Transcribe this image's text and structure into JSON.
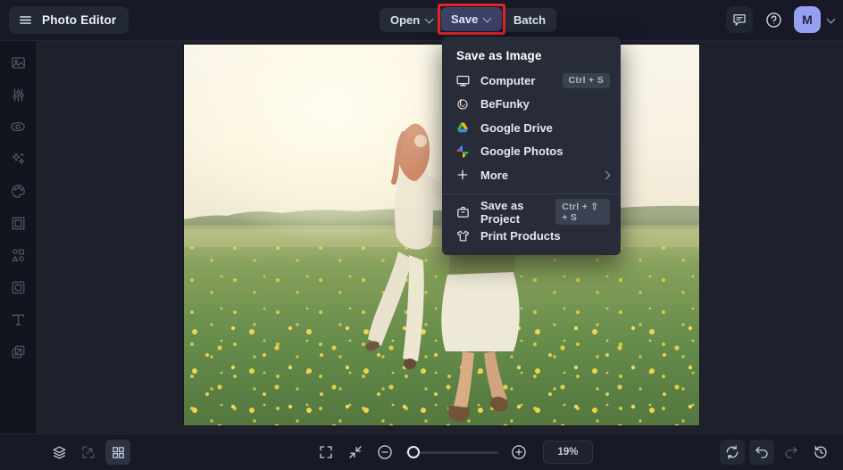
{
  "topbar": {
    "app_title": "Photo Editor",
    "open_label": "Open",
    "save_label": "Save",
    "batch_label": "Batch",
    "avatar_initial": "M",
    "icons": [
      "hamburger-icon",
      "chat-icon",
      "help-icon",
      "avatar-chevron-icon"
    ]
  },
  "save_menu": {
    "header": "Save as Image",
    "items": [
      {
        "label": "Computer",
        "icon": "computer-icon",
        "shortcut": "Ctrl + S"
      },
      {
        "label": "BeFunky",
        "icon": "befunky-icon"
      },
      {
        "label": "Google Drive",
        "icon": "google-drive-icon"
      },
      {
        "label": "Google Photos",
        "icon": "google-photos-icon"
      },
      {
        "label": "More",
        "icon": "plus-icon",
        "has_submenu": true
      }
    ],
    "project_items": [
      {
        "label": "Save as Project",
        "icon": "briefcase-icon",
        "shortcut": "Ctrl + ⇧ + S"
      },
      {
        "label": "Print Products",
        "icon": "tshirt-icon"
      }
    ]
  },
  "sidebar": {
    "tools": [
      "photo",
      "sliders",
      "eye",
      "sparkles",
      "palette",
      "frame",
      "shapes",
      "overlay",
      "text",
      "textures"
    ]
  },
  "statusbar": {
    "zoom_level": "19%",
    "icons_left": [
      "layers-icon",
      "resize-icon",
      "grid-icon"
    ],
    "icons_center": [
      "fullscreen-icon",
      "fit-screen-icon",
      "zoom-out-icon",
      "zoom-in-icon"
    ],
    "icons_right": [
      "reset-icon",
      "undo-icon",
      "redo-icon",
      "history-icon"
    ]
  },
  "canvas": {
    "image_alt": "Two women holding hands and dancing in a sunlit meadow full of yellow wildflowers under a bright hazy sky"
  },
  "colors": {
    "annotation_red": "#e02428",
    "avatar_bg": "#95a0f1",
    "save_active_bg": "#3d4166",
    "dropdown_bg": "#272c38",
    "topbar_bg": "#171a26"
  }
}
